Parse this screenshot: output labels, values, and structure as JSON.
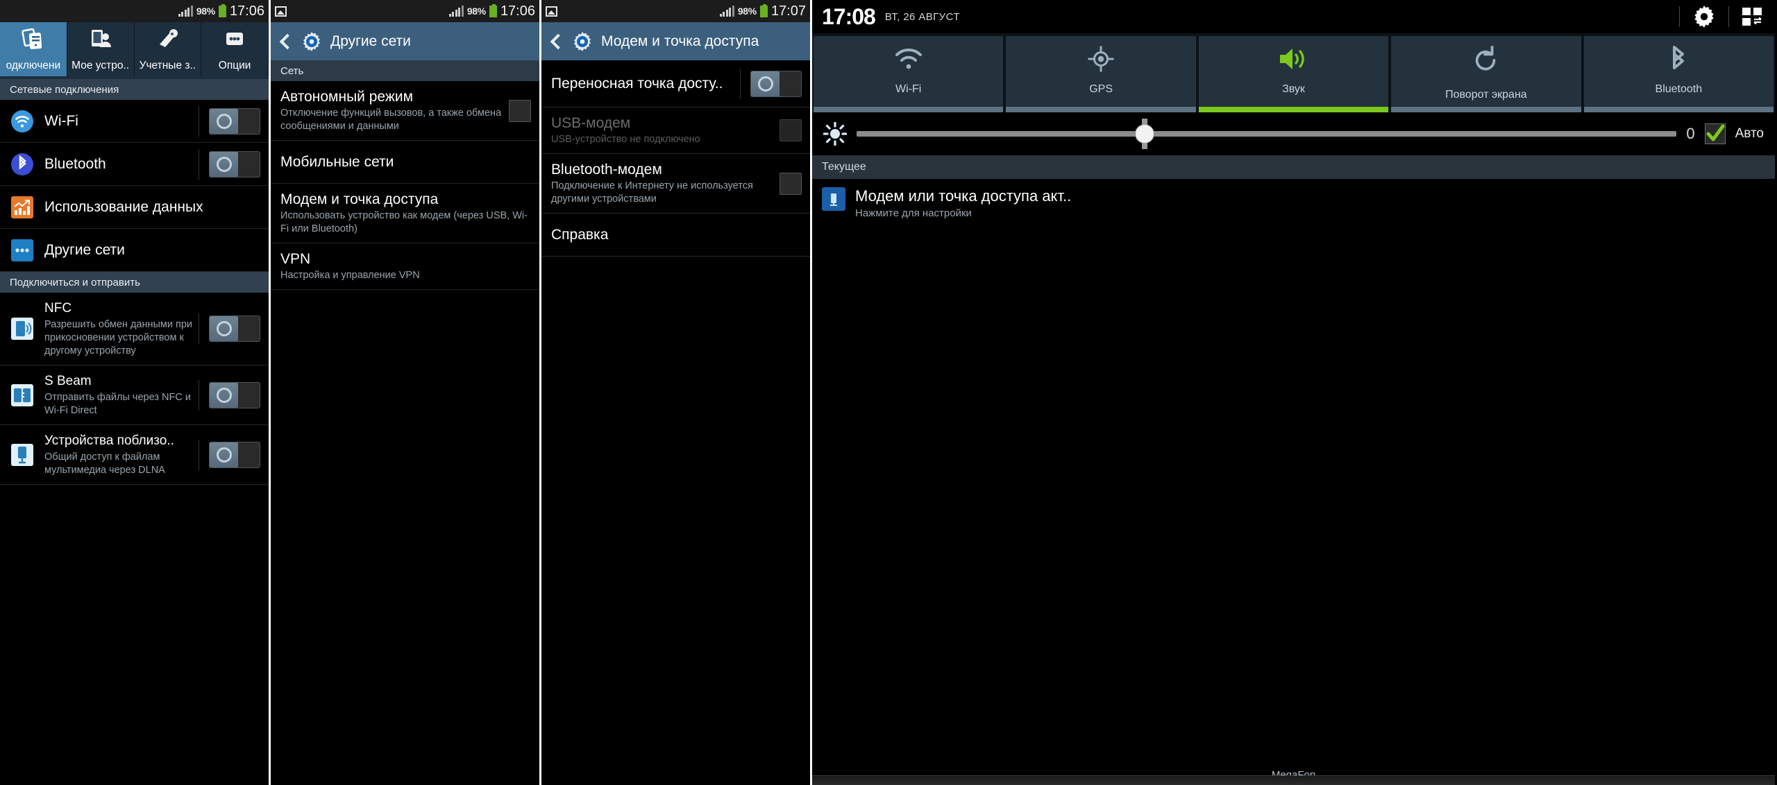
{
  "panel1": {
    "statusbar": {
      "battery_pct": "98%",
      "time": "17:06"
    },
    "tabs": [
      {
        "label": "одключени",
        "icon": "connections-icon",
        "active": true
      },
      {
        "label": "Мое устро..",
        "icon": "my-device-icon",
        "active": false
      },
      {
        "label": "Учетные з..",
        "icon": "accounts-icon",
        "active": false
      },
      {
        "label": "Опции",
        "icon": "more-options-icon",
        "active": false
      }
    ],
    "sections": [
      {
        "header": "Сетевые подключения",
        "rows": [
          {
            "title": "Wi-Fi",
            "sub": "",
            "icon": "wifi-icon",
            "control": "toggle"
          },
          {
            "title": "Bluetooth",
            "sub": "",
            "icon": "bluetooth-icon",
            "control": "toggle"
          },
          {
            "title": "Использование данных",
            "sub": "",
            "icon": "data-usage-icon",
            "control": "none"
          },
          {
            "title": "Другие сети",
            "sub": "",
            "icon": "other-networks-icon",
            "control": "none"
          }
        ]
      },
      {
        "header": "Подключиться и отправить",
        "rows": [
          {
            "title": "NFC",
            "sub": "Разрешить обмен данными при прикосновении устройством к другому устройству",
            "icon": "nfc-icon",
            "control": "toggle"
          },
          {
            "title": "S Beam",
            "sub": "Отправить файлы через NFC и Wi-Fi Direct",
            "icon": "sbeam-icon",
            "control": "toggle"
          },
          {
            "title": "Устройства поблизо..",
            "sub": "Общий доступ к файлам мультимедиа через DLNA",
            "icon": "nearby-devices-icon",
            "control": "toggle"
          }
        ]
      }
    ]
  },
  "panel2": {
    "statusbar": {
      "battery_pct": "98%",
      "time": "17:06"
    },
    "actionbar": {
      "title": "Другие сети",
      "back_icon": "back-chevron-icon",
      "app_icon": "settings-gear-icon"
    },
    "section_header": "Сеть",
    "rows": [
      {
        "title": "Автономный режим",
        "sub": "Отключение функций вызовов, а также обмена сообщениями и данными",
        "control": "checkbox"
      },
      {
        "title": "Мобильные сети",
        "sub": "",
        "control": "none"
      },
      {
        "title": "Модем и точка доступа",
        "sub": "Использовать устройство как модем (через USB, Wi-Fi или Bluetooth)",
        "control": "none"
      },
      {
        "title": "VPN",
        "sub": "Настройка и управление VPN",
        "control": "none"
      }
    ]
  },
  "panel3": {
    "statusbar": {
      "battery_pct": "98%",
      "time": "17:07"
    },
    "actionbar": {
      "title": "Модем и точка доступа",
      "back_icon": "back-chevron-icon",
      "app_icon": "settings-gear-icon"
    },
    "rows": [
      {
        "title": "Переносная точка досту..",
        "sub": "",
        "control": "toggle",
        "disabled": false
      },
      {
        "title": "USB-модем",
        "sub": "USB-устройство не подключено",
        "control": "checkbox",
        "disabled": true
      },
      {
        "title": "Bluetooth-модем",
        "sub": "Подключение к Интернету не используется другими устройствами",
        "control": "checkbox",
        "disabled": false
      },
      {
        "title": "Справка",
        "sub": "",
        "control": "none",
        "disabled": false
      }
    ]
  },
  "panel4": {
    "shade": {
      "time": "17:08",
      "date": "ВТ, 26 АВГУСТ",
      "settings_icon": "gear-icon",
      "grid_icon": "quick-settings-grid-icon"
    },
    "quick_toggles": [
      {
        "label": "Wi-Fi",
        "icon": "wifi-icon",
        "on": false
      },
      {
        "label": "GPS",
        "icon": "gps-icon",
        "on": false
      },
      {
        "label": "Звук",
        "icon": "sound-icon",
        "on": true
      },
      {
        "label": "Поворот экрана",
        "icon": "rotate-screen-icon",
        "on": false
      },
      {
        "label": "Bluetooth",
        "icon": "bluetooth-icon",
        "on": false
      }
    ],
    "brightness": {
      "icon": "brightness-icon",
      "value": "0",
      "auto_label": "Авто",
      "auto_checked": true,
      "slider_percent": 34
    },
    "current_header": "Текущее",
    "notification": {
      "icon": "tethering-icon",
      "title": "Модем или точка доступа акт..",
      "sub": "Нажмите для настройки"
    },
    "carrier": "MegaFon"
  }
}
